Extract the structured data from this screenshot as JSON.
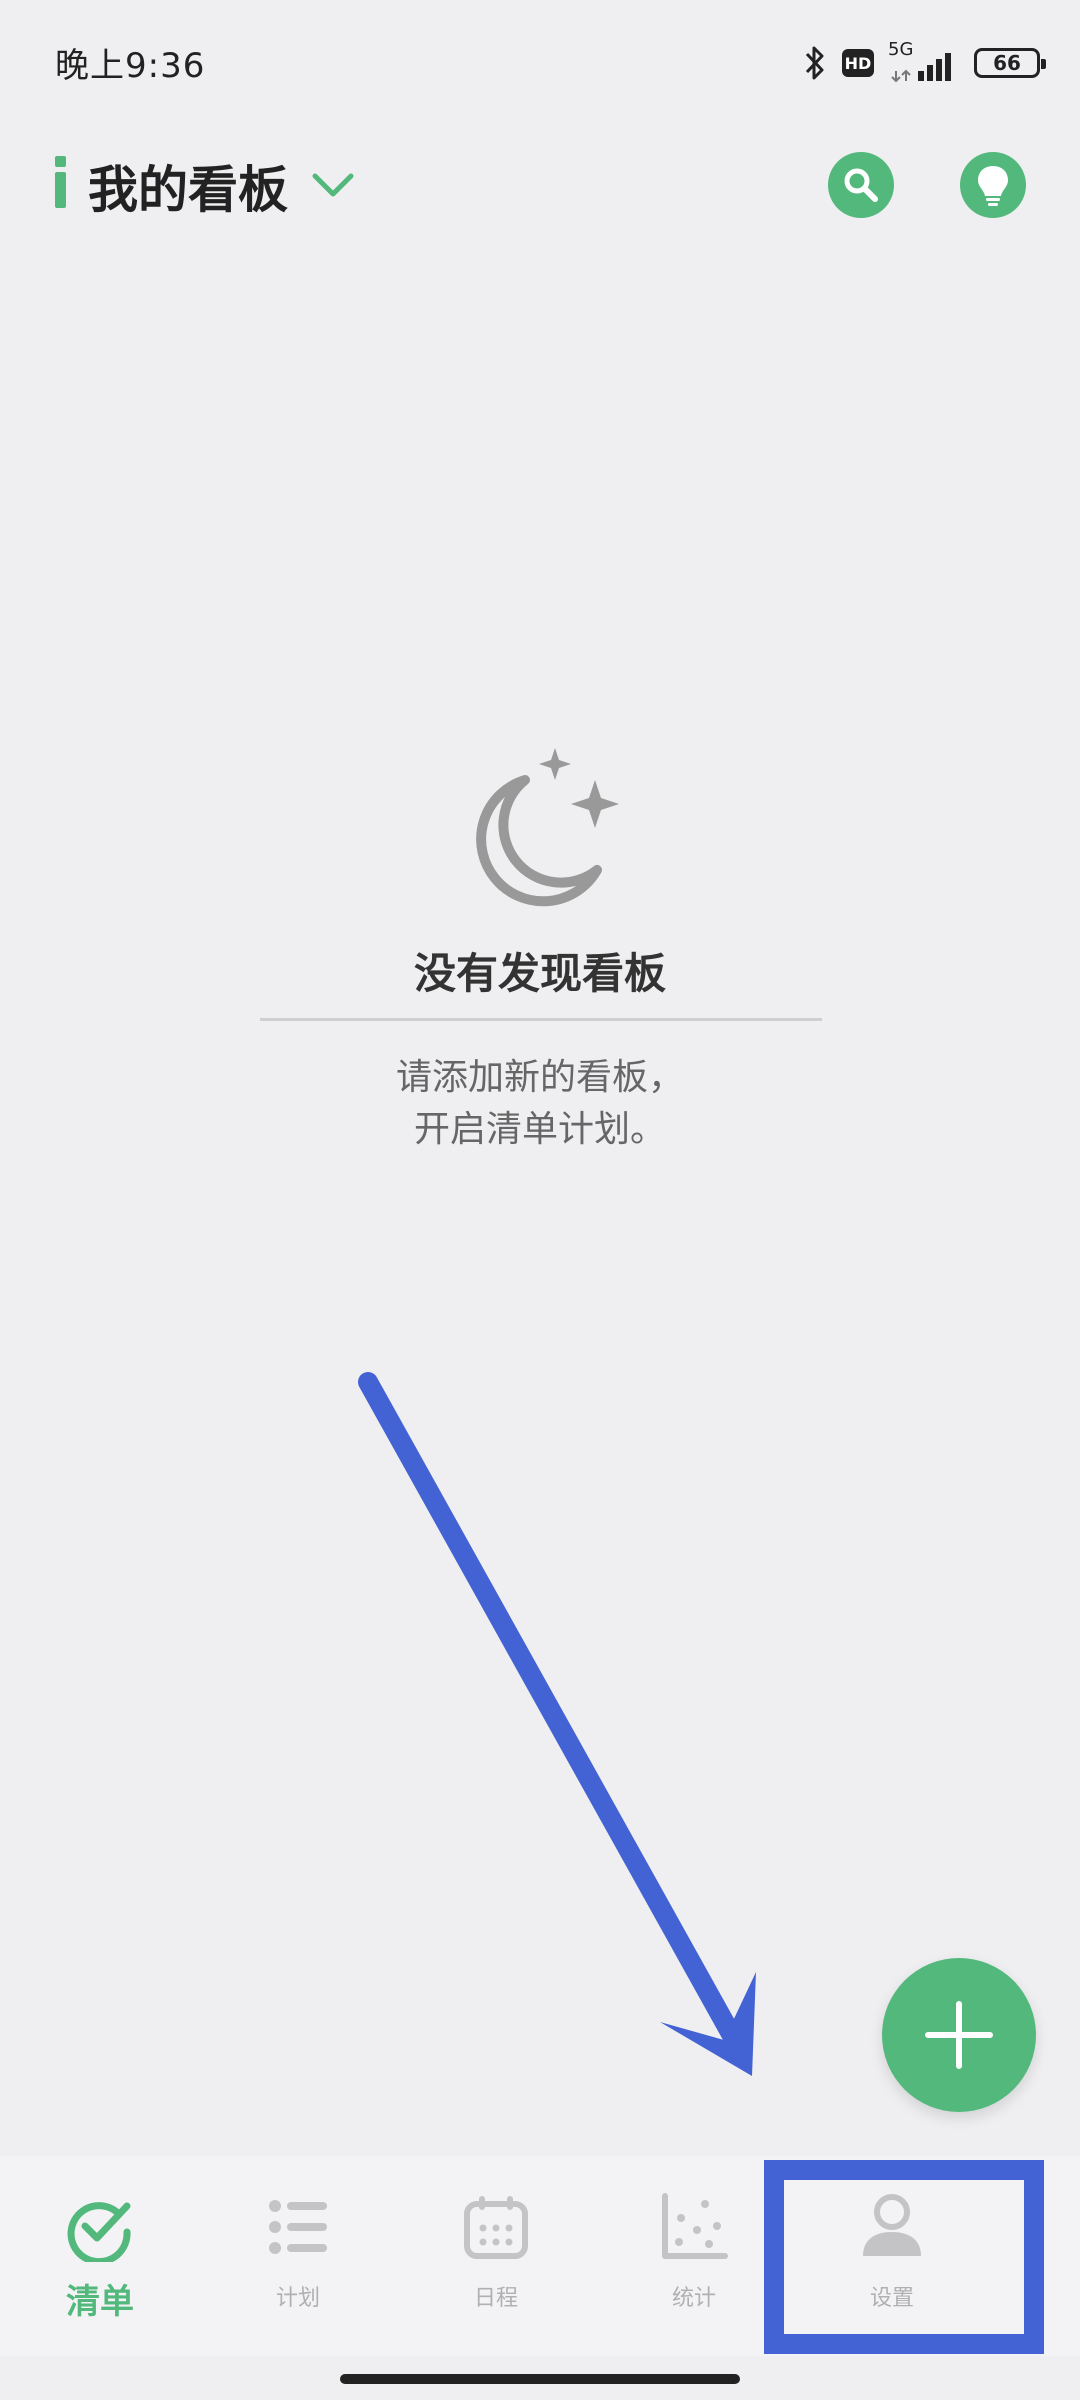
{
  "status_bar": {
    "time": "晚上9:36",
    "network": "5G",
    "hd_badge": "HD",
    "battery": "66"
  },
  "header": {
    "title": "我的看板",
    "accent_color": "#52b87b"
  },
  "empty_state": {
    "title": "没有发现看板",
    "line1": "请添加新的看板，",
    "line2": "开启清单计划。"
  },
  "fab": {
    "icon": "plus-icon"
  },
  "bottom_nav": {
    "items": [
      {
        "label": "清单",
        "icon": "check-circle-icon",
        "active": true
      },
      {
        "label": "计划",
        "icon": "list-icon",
        "active": false
      },
      {
        "label": "日程",
        "icon": "calendar-icon",
        "active": false
      },
      {
        "label": "统计",
        "icon": "scatter-chart-icon",
        "active": false
      },
      {
        "label": "设置",
        "icon": "user-icon",
        "active": false
      }
    ]
  },
  "annotation": {
    "arrow_color": "#4363d4"
  }
}
